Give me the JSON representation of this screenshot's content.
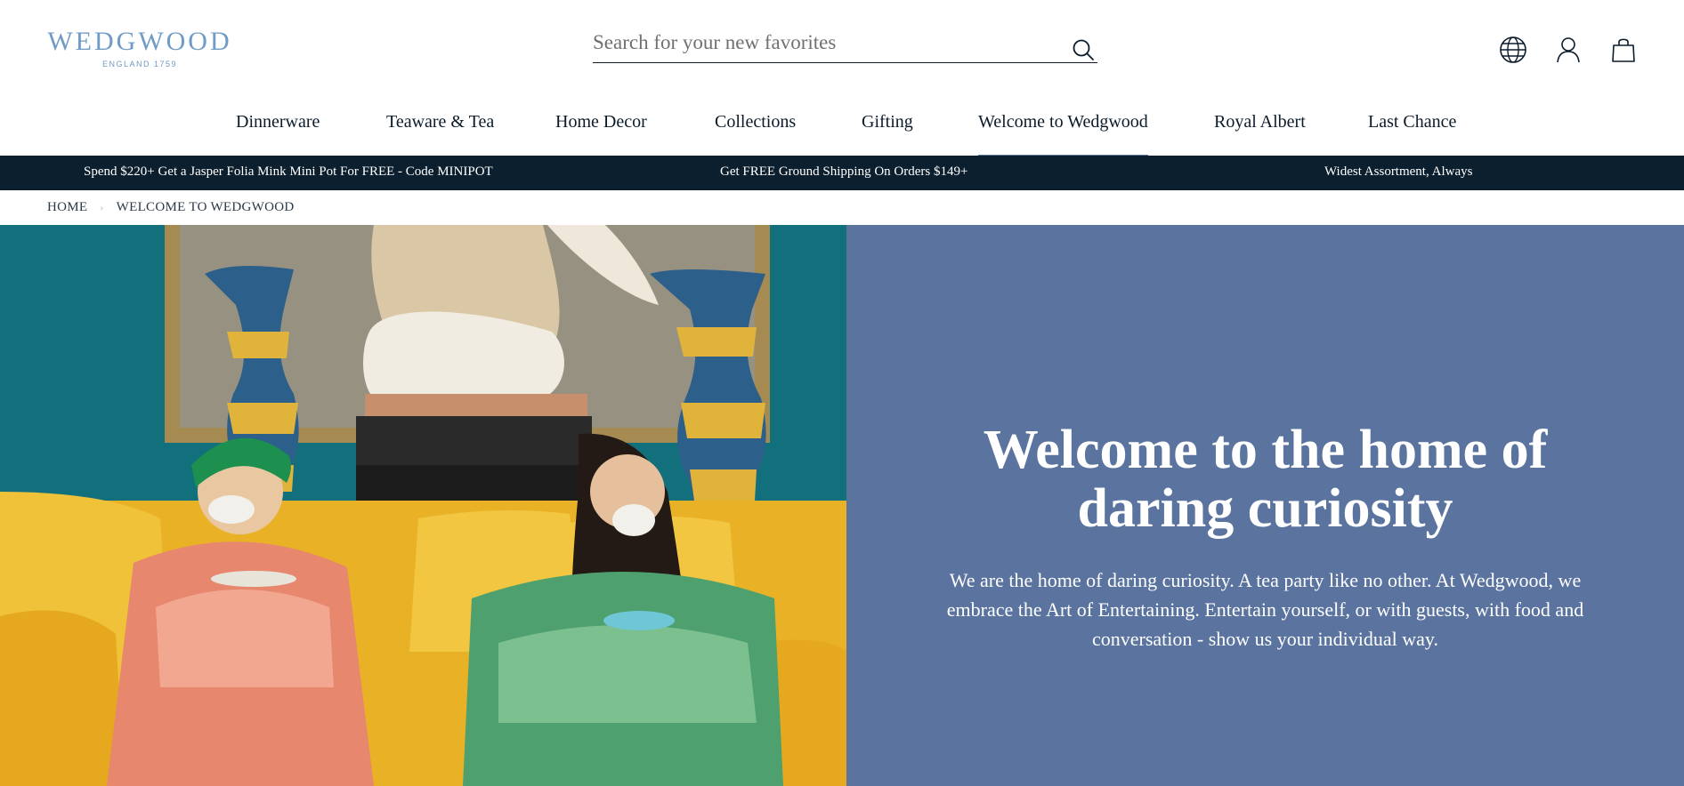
{
  "logo": {
    "word": "WEDGWOOD",
    "sub": "ENGLAND 1759"
  },
  "search": {
    "placeholder": "Search for your new favorites"
  },
  "icons": {
    "search": "search-icon",
    "globe": "globe-icon",
    "account": "user-icon",
    "bag": "shopping-bag-icon"
  },
  "nav": {
    "items": [
      {
        "label": "Dinnerware"
      },
      {
        "label": "Teaware & Tea"
      },
      {
        "label": "Home Decor"
      },
      {
        "label": "Collections"
      },
      {
        "label": "Gifting"
      },
      {
        "label": "Welcome to Wedgwood",
        "active": true
      },
      {
        "label": "Royal Albert"
      },
      {
        "label": "Last Chance"
      }
    ]
  },
  "promo": [
    "Spend $220+ Get a Jasper Folia Mink Mini Pot For FREE - Code MINIPOT",
    "Get FREE Ground Shipping On Orders $149+",
    "Widest Assortment, Always"
  ],
  "breadcrumb": {
    "home": "HOME",
    "current": "WELCOME TO WEDGWOOD"
  },
  "hero": {
    "title_line1": "Welcome to the home of",
    "title_line2": "daring curiosity",
    "body": "We are the home of daring curiosity. A tea party like no other. At Wedgwood, we embrace the Art of Entertaining. Entertain yourself, or with guests, with food and conversation - show us your individual way."
  },
  "colors": {
    "brand_blue": "#6f9bc6",
    "navy": "#0c1f2e",
    "panel": "#5a739f",
    "active_underline": "#5a739f"
  }
}
